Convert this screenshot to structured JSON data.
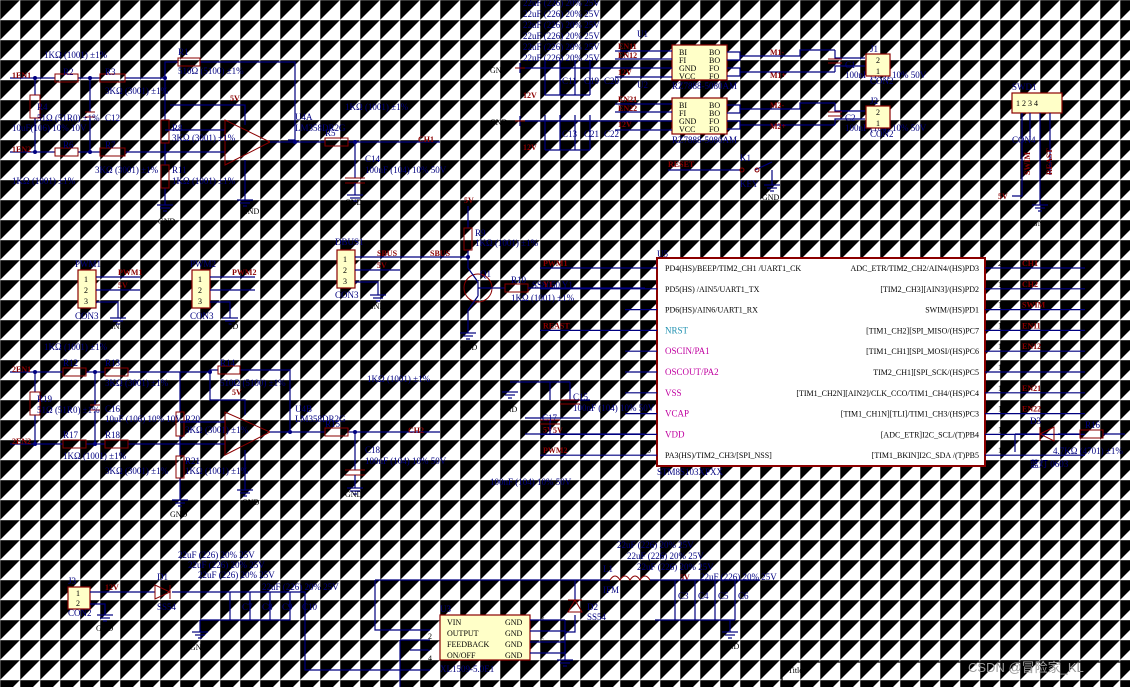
{
  "top_left": {
    "r_top1": "1KΩ (1001) ±1%",
    "r1": "R1",
    "r1_val": "510Ω (5100) ±1%",
    "en1": "1EN1",
    "en2": "1EN2",
    "r2": "R2",
    "r3": "R3",
    "r3_val": "3KΩ (3001) ±1%",
    "r4": "R4",
    "r4_val": "51Ω (51R0) ±1%",
    "c12": "C12",
    "c12_val": "10uF(106) 10% 10V",
    "r6": "R6",
    "r7": "R7",
    "r7_val": "3KΩ (3001) ±1%",
    "r8": "R8",
    "r8_val": "3KΩ (3001) ±1%",
    "r11": "R11",
    "r11_val": "1KΩ (1001) ±1%",
    "r_bottom": "1KΩ (1001) ±1%",
    "u4a": "U4A",
    "u4a_part": "LM358DR2G",
    "r5": "R5",
    "r5_val": "1KΩ (1001) ±1%",
    "c14": "C14",
    "c14_val": "100nF (104) 10% 50V",
    "ch1": "CH1",
    "v5": "5V",
    "gnd": "GND"
  },
  "mid_left": {
    "r_top1": "1KΩ (1001) ±1%",
    "r12": "R12",
    "r13": "R13",
    "r13_val": "3KΩ (3001) ±1%",
    "r14": "R14",
    "r14_val": "510Ω (5100) ±1%",
    "en1": "2EN1",
    "en2": "2EN2",
    "r19": "R19",
    "r19_val": "51Ω (51R0) ±1%",
    "c16": "C16",
    "c16_val": "10uF (106) 10% 10V",
    "r17": "R17",
    "r17_val": "1KΩ (1001) ±1%",
    "r18": "R18",
    "r18_val": "3KΩ (3001) ±1%",
    "r20": "R20",
    "r20_val": "3KΩ (3001) ±1%",
    "r21": "R21",
    "r21_val": "1KΩ (1001) ±1%",
    "u4b": "U4B",
    "u4b_part": "LM358DR2G",
    "r15": "R15",
    "r15_val": "1KΩ (1001) ±1%",
    "c18": "C18",
    "c18_val": "100nF (104) 10% 50V",
    "ch2": "CH2"
  },
  "pwm": {
    "pwm1": "PWM1",
    "pwm2": "PWM2",
    "con3": "CON3",
    "pwm1_net": "PWM1",
    "pwm2_net": "PWM2",
    "v5": "5V"
  },
  "dbus": {
    "dbus1": "DBUS1",
    "sbus": "SBUS",
    "con3": "CON3",
    "v5": "5V",
    "r9": "R9",
    "r9_val": "1KΩ (1001) ±1%",
    "q1": "Q1",
    "r10": "R10",
    "r10_val": "1KΩ (1001) ±1%",
    "ss8050": "SS8050 Y1"
  },
  "motor": {
    "caps": [
      "22uF (226) 20% 25V",
      "22uF (226) 20% 25V",
      "22uF (226) 20% 25V",
      "22uF (226) 20% 25V",
      "22uF (226) 20% 25V",
      "22uF (226) 20% 25V"
    ],
    "u1": "U1",
    "u2": "U2",
    "part": "RZ7888-5080AM",
    "en11": "EN11",
    "en12": "EN12",
    "en21": "EN21",
    "en22": "EN22",
    "pins_l": [
      "BI",
      "FI",
      "GND",
      "VCC"
    ],
    "pins_r": [
      "BO",
      "BO",
      "FO",
      "FO"
    ],
    "m1n": "M1-",
    "m1p": "M1+",
    "m2n": "M2-",
    "m2p": "M2+",
    "c1": "C1",
    "c2": "C2",
    "c_val": "100nF (104) 10% 50V",
    "j1": "J1",
    "j2": "J2",
    "con2": "CON2",
    "c11": "C11",
    "c19": "C19",
    "c20": "C20",
    "c13": "C13",
    "c21": "C21",
    "c22": "C22",
    "v12": "12V",
    "gnd": "GND"
  },
  "reset": {
    "net": "RESET",
    "k1": "K1",
    "key": "KEY",
    "gnd": "GND"
  },
  "swd": {
    "swd1": "SWD1",
    "con4": "CON4",
    "swim": "SWIM",
    "rast": "REAST",
    "v5": "5V",
    "gnd": "GND"
  },
  "mcu": {
    "u5": "U5",
    "part": "STM8S103XPXX",
    "left_pins": [
      {
        "num": "1",
        "name": "PD4(HS)/BEEP/TIM2_CH1 /UART1_CK",
        "net": "PWM1"
      },
      {
        "num": "2",
        "name": "PD5(HS) /AIN5/UART1_TX",
        "net": "Y1"
      },
      {
        "num": "3",
        "name": "PD6(HS)/AIN6/UART1_RX",
        "net": ""
      },
      {
        "num": "4",
        "name": "NRST",
        "net": "REAST"
      },
      {
        "num": "5",
        "name": "OSCIN/PA1",
        "net": ""
      },
      {
        "num": "6",
        "name": "OSCOUT/PA2",
        "net": ""
      },
      {
        "num": "7",
        "name": "VSS",
        "net": ""
      },
      {
        "num": "8",
        "name": "VCAP",
        "net": ""
      },
      {
        "num": "9",
        "name": "VDD",
        "net": "5V"
      },
      {
        "num": "10",
        "name": "PA3(HS)/TIM2_CH3/[SPI_NSS]",
        "net": "PWM2"
      }
    ],
    "right_pins": [
      {
        "num": "20",
        "name": "ADC_ETR/TIM2_CH2/AIN4/(HS)PD3",
        "net": "CH1"
      },
      {
        "num": "19",
        "name": "[TIM2_CH3][AIN3]/(HS)PD2",
        "net": "CH2"
      },
      {
        "num": "18",
        "name": "SWIM/(HS)PD1",
        "net": "SWIM"
      },
      {
        "num": "17",
        "name": "[TIM1_CH2][SPI_MISO/(HS)PC7",
        "net": "EN11"
      },
      {
        "num": "16",
        "name": "[TIM1_CH1][SPI_MOSI/(HS)PC6",
        "net": "EN12"
      },
      {
        "num": "15",
        "name": "TIM2_CH1][SPI_SCK/(HS)PC5",
        "net": ""
      },
      {
        "num": "14",
        "name": "[TIM1_CH2N][AIN2]/CLK_CCO/TIM1_CH4/(HS)PC4",
        "net": "EN21"
      },
      {
        "num": "13",
        "name": "[TIM1_CH1N][TLI]/TIM1_CH3/(HS)PC3",
        "net": "EN22"
      },
      {
        "num": "12",
        "name": "[ADC_ETR]I2C_SCL/(T)PB4",
        "net": ""
      },
      {
        "num": "11",
        "name": "[TIM1_BKIN]I2C_SDA /(T)PB5",
        "net": ""
      }
    ],
    "c15": "C15",
    "c15_val": "100nF (104) 10% 50V",
    "c17": "C17",
    "c17_val": "100nF (104) 10% 50V",
    "v5": "5V",
    "gnd": "GND"
  },
  "led": {
    "d3": "D3",
    "label": "蓝灯 0603",
    "r16": "R16",
    "r16_val": "4.7KΩ (4701) ±1%"
  },
  "power": {
    "j3": "J3",
    "con2": "CON2",
    "v12": "12V",
    "d1": "D1",
    "d1_part": "SS54",
    "caps": [
      "22uF (226) 20% 25V",
      "22uF (226) 20% 25V",
      "22uF (226) 20% 25V",
      "22uF (226) 20% 25V"
    ],
    "c7": "C7",
    "c8": "C8",
    "c9": "C9",
    "c10": "C10",
    "u3": "U3",
    "u3_part": "XL1509-5.0E1",
    "u3_left": [
      "VIN",
      "OUTPUT",
      "FEEDBACK",
      "ON/OFF"
    ],
    "u3_right": [
      "GND",
      "GND",
      "GND",
      "GND"
    ],
    "u3_lnum": [
      "1",
      "2",
      "3",
      "4"
    ],
    "u3_rnum": [
      "8",
      "7",
      "6",
      "5"
    ],
    "d2": "D2",
    "d2_part": "SS54",
    "l1": "L1",
    "l1_part": "IFM",
    "caps2": [
      "22uF (226) 20% 25V",
      "22uF (226) 20% 25V",
      "22uF (226) 20% 25V",
      "22uF (226) 20% 25V"
    ],
    "c3": "C3",
    "c4": "C4",
    "c5": "C5",
    "c6": "C6",
    "v5": "5V",
    "gnd": "GND"
  },
  "title_block": {
    "title": "Title"
  },
  "watermark": "CSDN @冒险家_KL"
}
